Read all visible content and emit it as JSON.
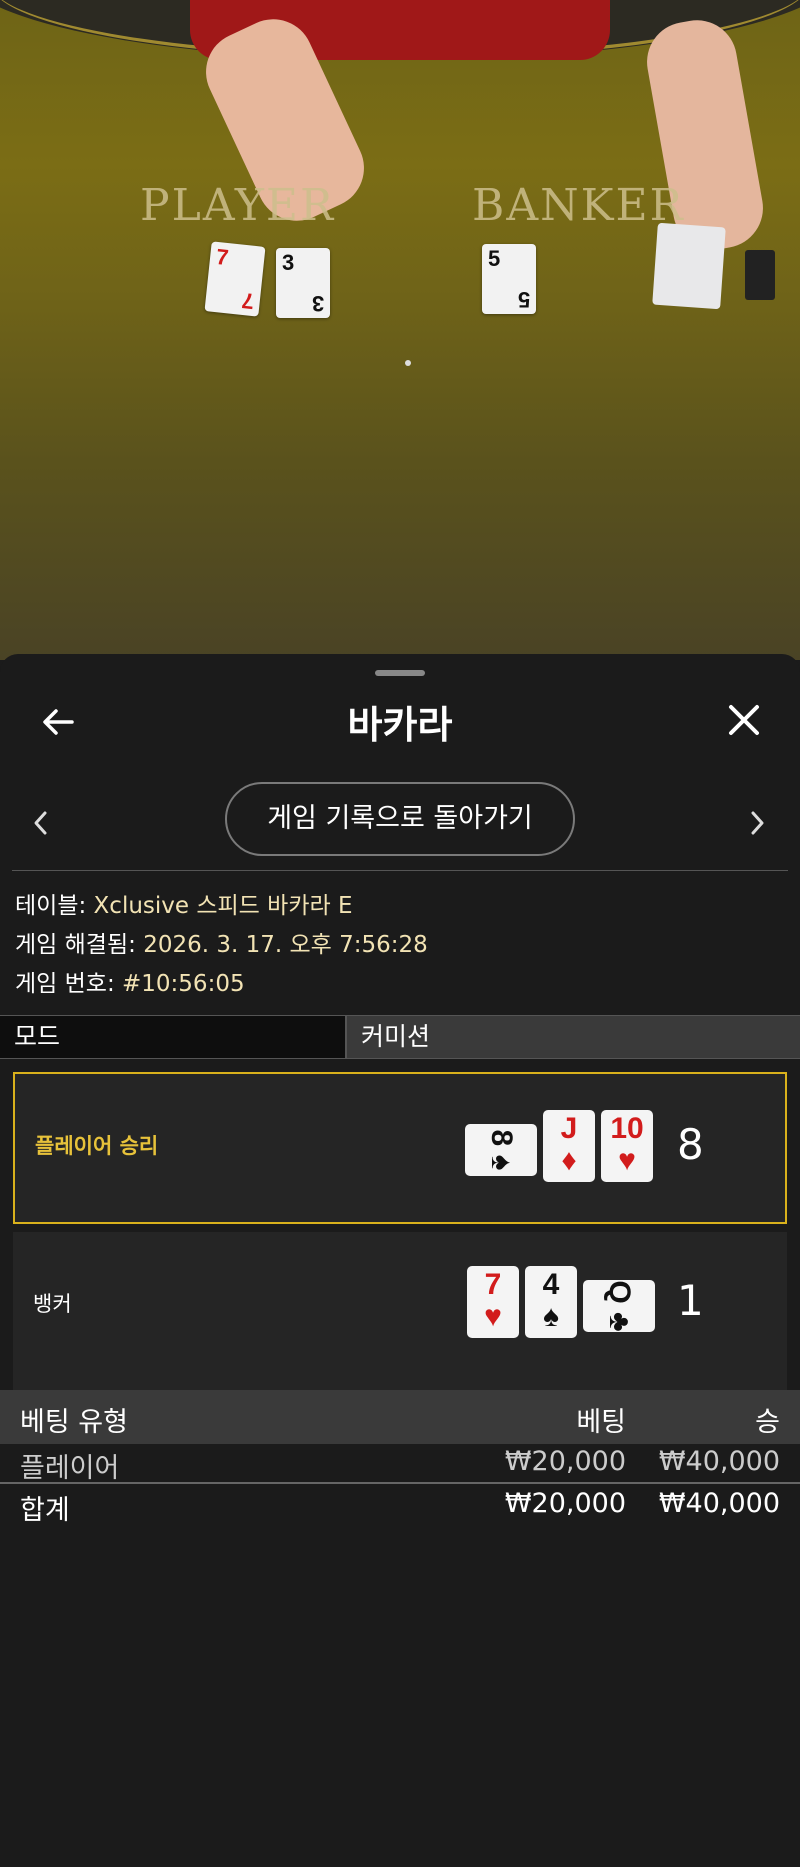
{
  "video": {
    "player_label": "PLAYER",
    "banker_label": "BANKER",
    "player_cards": [
      {
        "rank": "7",
        "suit": "♦",
        "color": "#d21c1c"
      },
      {
        "rank": "3",
        "suit": "♠",
        "color": "#111111"
      }
    ],
    "banker_cards": [
      {
        "rank": "5",
        "suit": "♠",
        "color": "#111111"
      }
    ]
  },
  "header": {
    "title": "바카라",
    "back_icon": "arrow-left-icon",
    "close_icon": "close-icon"
  },
  "nav": {
    "back_to_history_label": "게임 기록으로 돌아가기"
  },
  "info": {
    "table_label": "테이블:",
    "table_value": "Xclusive 스피드 바카라 E",
    "resolved_label": "게임 해결됨:",
    "resolved_value": "2026. 3. 17. 오후 7:56:28",
    "game_no_label": "게임 번호:",
    "game_no_value": "#10:56:05"
  },
  "tabs": [
    {
      "label": "모드",
      "active": true
    },
    {
      "label": "커미션",
      "active": false
    }
  ],
  "outcome": {
    "player": {
      "label": "플레이어 승리",
      "score": "8",
      "cards": [
        {
          "rank": "8",
          "suit": "♠",
          "color": "#111111",
          "sideways": true
        },
        {
          "rank": "J",
          "suit": "♦",
          "color": "#d21c1c",
          "sideways": false
        },
        {
          "rank": "10",
          "suit": "♥",
          "color": "#d21c1c",
          "sideways": false
        }
      ]
    },
    "banker": {
      "label": "뱅커",
      "score": "1",
      "cards": [
        {
          "rank": "7",
          "suit": "♥",
          "color": "#d21c1c",
          "sideways": false
        },
        {
          "rank": "4",
          "suit": "♠",
          "color": "#111111",
          "sideways": false
        },
        {
          "rank": "Q",
          "suit": "♣",
          "color": "#111111",
          "sideways": true
        }
      ]
    }
  },
  "bets_table": {
    "headers": {
      "type": "베팅 유형",
      "bet": "베팅",
      "win": "승"
    },
    "rows": [
      {
        "type": "플레이어",
        "bet": "₩20,000",
        "win": "₩40,000"
      }
    ],
    "total": {
      "type": "합계",
      "bet": "₩20,000",
      "win": "₩40,000"
    }
  },
  "colors": {
    "win_border": "#d9b11c",
    "win_label": "#e7c23a",
    "info_value": "#f2e3b4",
    "sheet_bg": "#1b1b1b"
  }
}
